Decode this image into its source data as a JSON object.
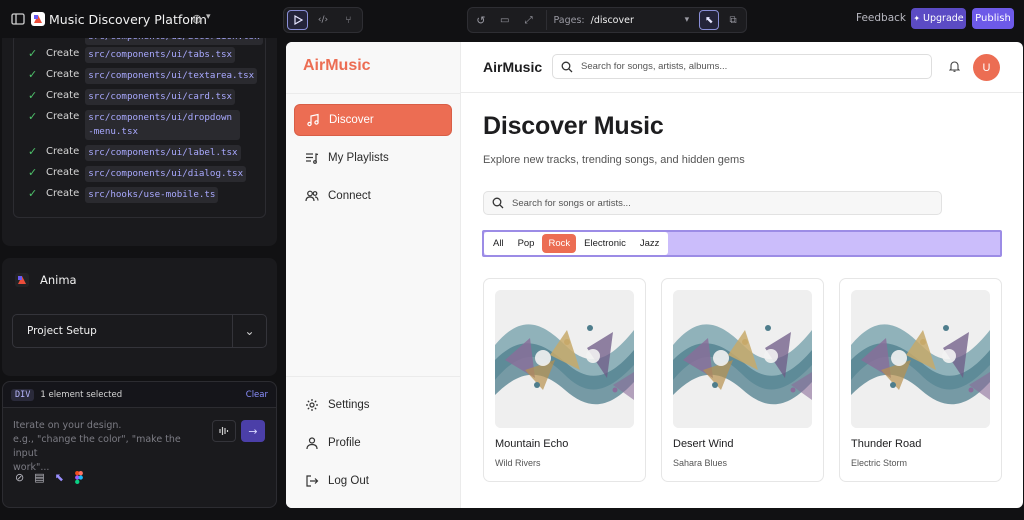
{
  "topbar": {
    "project_title": "Music Discovery Platform",
    "pages_label": "Pages:",
    "pages_value": "/discover",
    "feedback": "Feedback",
    "upgrade": "Upgrade",
    "publish": "Publish"
  },
  "log": {
    "items": [
      {
        "action": "Create",
        "path": "src/components/ui/tabs.tsx"
      },
      {
        "action": "Create",
        "path": "src/components/ui/textarea.tsx"
      },
      {
        "action": "Create",
        "path": "src/components/ui/card.tsx"
      },
      {
        "action": "Create",
        "path": "src/components/ui/dropdown-menu.tsx"
      },
      {
        "action": "Create",
        "path": "src/components/ui/label.tsx"
      },
      {
        "action": "Create",
        "path": "src/components/ui/dialog.tsx"
      },
      {
        "action": "Create",
        "path": "src/hooks/use-mobile.ts"
      }
    ]
  },
  "anima": {
    "name": "Anima",
    "project_setup": "Project Setup"
  },
  "chat": {
    "badge": "DIV",
    "selection": "1 element selected",
    "clear": "Clear",
    "placeholder": "Iterate on your design.\ne.g., \"change the color\", \"make the input work\"..."
  },
  "app": {
    "brand": "AirMusic",
    "nav": [
      {
        "label": "Discover",
        "icon": "music-note-icon",
        "active": true
      },
      {
        "label": "My Playlists",
        "icon": "playlist-icon",
        "active": false
      },
      {
        "label": "Connect",
        "icon": "users-icon",
        "active": false
      }
    ],
    "nav_bottom": [
      {
        "label": "Settings",
        "icon": "gear-icon"
      },
      {
        "label": "Profile",
        "icon": "user-icon"
      },
      {
        "label": "Log Out",
        "icon": "logout-icon"
      }
    ],
    "header_title": "AirMusic",
    "header_search_placeholder": "Search for songs, artists, albums...",
    "avatar_initial": "U",
    "page_title": "Discover Music",
    "page_subtitle": "Explore new tracks, trending songs, and hidden gems",
    "content_search_placeholder": "Search for songs or artists...",
    "genres": [
      "All",
      "Pop",
      "Rock",
      "Electronic",
      "Jazz"
    ],
    "active_genre": "Rock",
    "cards": [
      {
        "title": "Mountain Echo",
        "artist": "Wild Rivers"
      },
      {
        "title": "Desert Wind",
        "artist": "Sahara Blues"
      },
      {
        "title": "Thunder Road",
        "artist": "Electric Storm"
      }
    ]
  },
  "colors": {
    "accent": "#ec6d53",
    "selection_highlight": "#cbbdfb",
    "publish": "#6d5ae8"
  }
}
